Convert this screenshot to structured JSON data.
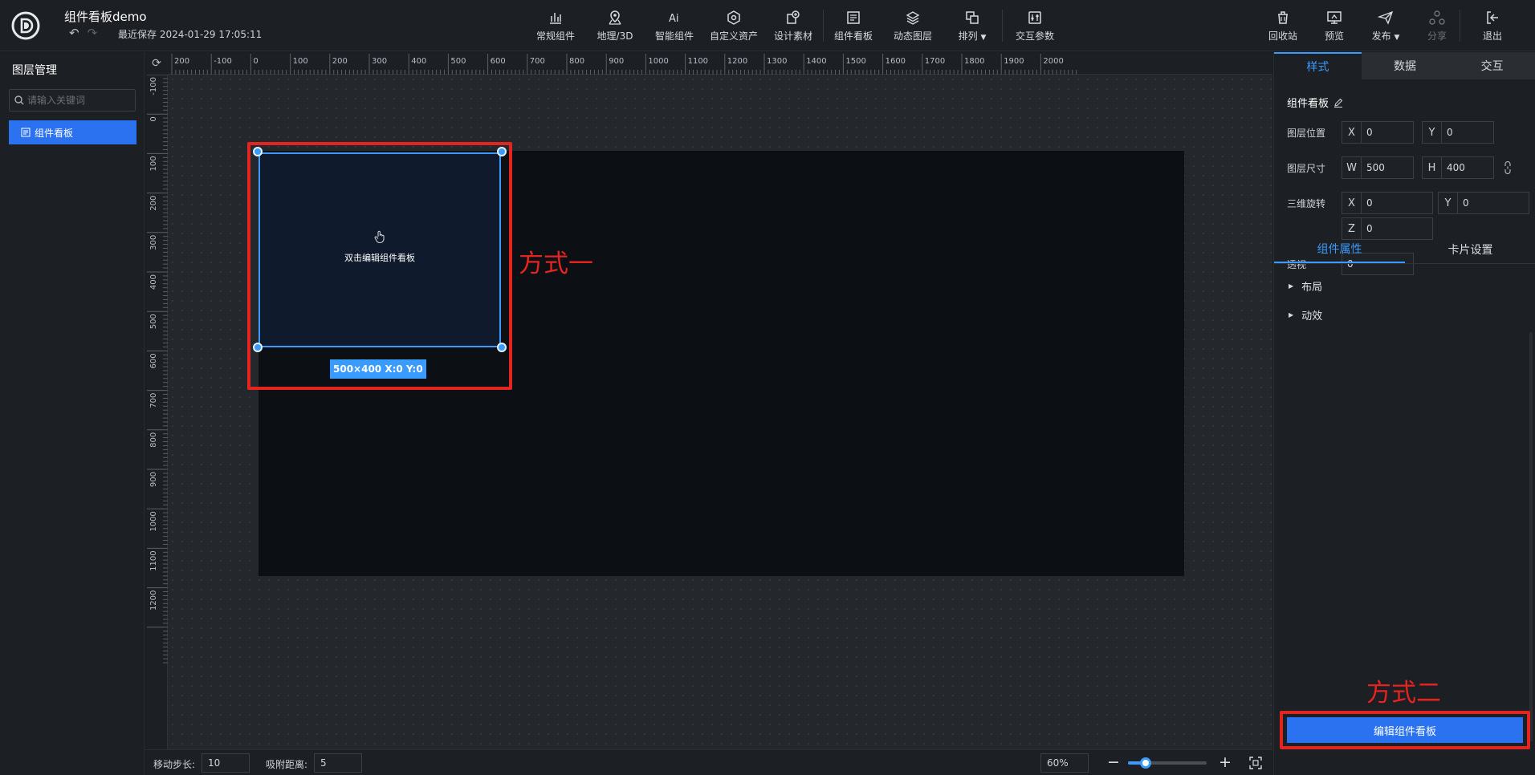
{
  "app": {
    "title": "组件看板demo",
    "save_time": "最近保存 2024-01-29 17:05:11",
    "undo_icon": "undo-icon",
    "redo_icon": "redo-icon"
  },
  "toolbar": {
    "items": [
      {
        "label": "常规组件",
        "icon": "bar-chart-icon"
      },
      {
        "label": "地理/3D",
        "icon": "map-pin-icon"
      },
      {
        "label": "智能组件",
        "icon": "ai-icon"
      },
      {
        "label": "自定义资产",
        "icon": "hexagon-icon"
      },
      {
        "label": "设计素材",
        "icon": "material-icon"
      },
      {
        "label": "组件看板",
        "icon": "board-icon"
      },
      {
        "label": "动态图层",
        "icon": "layers-icon"
      },
      {
        "label": "排列",
        "icon": "arrange-icon"
      },
      {
        "label": "交互参数",
        "icon": "sliders-icon"
      }
    ],
    "right": [
      {
        "label": "回收站",
        "icon": "trash-icon"
      },
      {
        "label": "预览",
        "icon": "preview-icon"
      },
      {
        "label": "发布",
        "icon": "send-icon"
      },
      {
        "label": "分享",
        "icon": "share-icon"
      },
      {
        "label": "退出",
        "icon": "exit-icon"
      }
    ]
  },
  "left_panel": {
    "title": "图层管理",
    "search_placeholder": "请输入关键词",
    "layers": [
      {
        "label": "组件看板"
      }
    ]
  },
  "canvas": {
    "ruler_h": [
      "200",
      "-100",
      "0",
      "100",
      "200",
      "300",
      "400",
      "500",
      "600",
      "700",
      "800",
      "900",
      "1000",
      "1100",
      "1200",
      "1300",
      "1400",
      "1500",
      "1600",
      "1700",
      "1800",
      "1900",
      "2000"
    ],
    "ruler_v": [
      "-100",
      "0",
      "100",
      "200",
      "300",
      "400",
      "500",
      "600",
      "700",
      "800",
      "900",
      "1000",
      "1100",
      "1200"
    ],
    "component_hint": "双击编辑组件看板",
    "size_tag": "500×400   X:0 Y:0",
    "annotation_1": "方式一"
  },
  "status_bar": {
    "move_step_label": "移动步长:",
    "move_step_value": "10",
    "snap_label": "吸附距离:",
    "snap_value": "5",
    "zoom_value": "60%",
    "zoom_slider_fraction": 0.22
  },
  "right_panel": {
    "tabs": [
      "样式",
      "数据",
      "交互"
    ],
    "active_tab": 0,
    "component_name": "组件看板",
    "position_label": "图层位置",
    "pos_x": "0",
    "pos_y": "0",
    "size_label": "图层尺寸",
    "width": "500",
    "height": "400",
    "rotate_label": "三维旋转",
    "rot_x": "0",
    "rot_y": "0",
    "rot_z": "0",
    "perspective_label": "透视",
    "perspective": "0",
    "axis_x": "X",
    "axis_y": "Y",
    "axis_z": "Z",
    "axis_w": "W",
    "axis_h": "H",
    "sub_tabs": [
      "组件属性",
      "卡片设置"
    ],
    "sections": [
      "布局",
      "动效"
    ],
    "edit_button": "编辑组件看板",
    "annotation_2": "方式二"
  },
  "colors": {
    "accent": "#2b72f0",
    "selection": "#3a9bff",
    "annotation": "#e3241f",
    "background": "#1c1f23"
  }
}
